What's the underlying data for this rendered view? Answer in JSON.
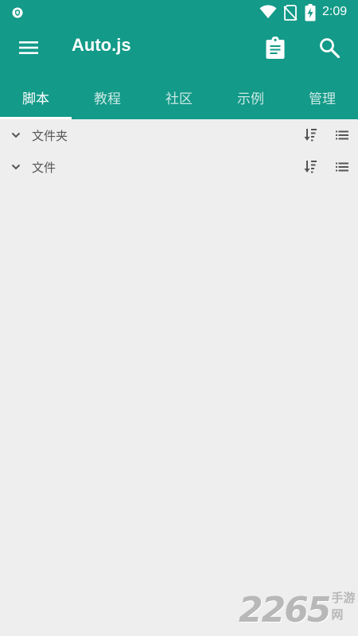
{
  "status_bar": {
    "time": "2:09",
    "icons": [
      "shield-icon",
      "wifi-icon",
      "no-sim-icon",
      "battery-charging-icon"
    ]
  },
  "toolbar": {
    "title": "Auto.js",
    "menu_icon": "hamburger-menu-icon",
    "actions": [
      "clipboard-icon",
      "search-icon"
    ]
  },
  "tabs": [
    {
      "label": "脚本",
      "active": true
    },
    {
      "label": "教程",
      "active": false
    },
    {
      "label": "社区",
      "active": false
    },
    {
      "label": "示例",
      "active": false
    },
    {
      "label": "管理",
      "active": false
    }
  ],
  "sections": [
    {
      "label": "文件夹",
      "icons": [
        "chevron-down-icon",
        "sort-icon",
        "list-view-icon"
      ]
    },
    {
      "label": "文件",
      "icons": [
        "chevron-down-icon",
        "sort-icon",
        "list-view-icon"
      ]
    }
  ],
  "watermark": {
    "number": "2265",
    "text": "手游网"
  },
  "colors": {
    "primary": "#139a88",
    "background": "#eeeeee",
    "text_secondary": "#555555"
  }
}
